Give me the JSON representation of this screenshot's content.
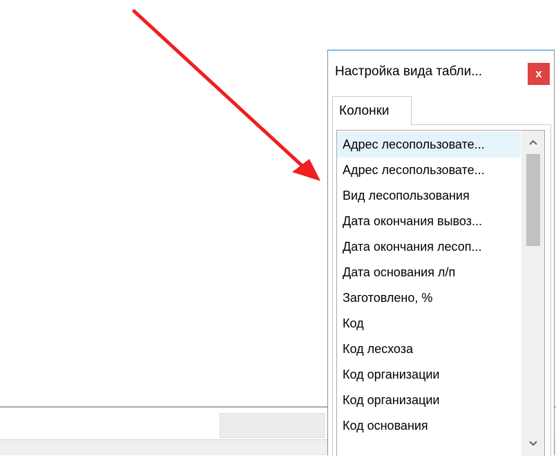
{
  "dialog": {
    "title": "Настройка вида табли...",
    "close_label": "x",
    "tabs": [
      {
        "label": "Колонки"
      }
    ]
  },
  "columns_list": {
    "items": [
      {
        "label": "Адрес лесопользовате..."
      },
      {
        "label": "Адрес лесопользовате..."
      },
      {
        "label": "Вид лесопользования"
      },
      {
        "label": "Дата окончания вывоз..."
      },
      {
        "label": "Дата окончания лесоп..."
      },
      {
        "label": "Дата основания л/п"
      },
      {
        "label": "Заготовлено, %"
      },
      {
        "label": "Код"
      },
      {
        "label": "Код лесхоза"
      },
      {
        "label": "Код организации"
      },
      {
        "label": "Код организации"
      },
      {
        "label": "Код основания"
      }
    ],
    "selected_index": 0,
    "scroll_position": 0
  },
  "colors": {
    "arrow": "#ee2020",
    "close_button": "#e04343",
    "selection": "#e5f3fb",
    "dialog_accent": "#1e7fd0"
  },
  "icons": {
    "close": "close-icon",
    "scroll_up": "chevron-up-icon",
    "scroll_down": "chevron-down-icon",
    "arrow": "arrow-annotation"
  }
}
